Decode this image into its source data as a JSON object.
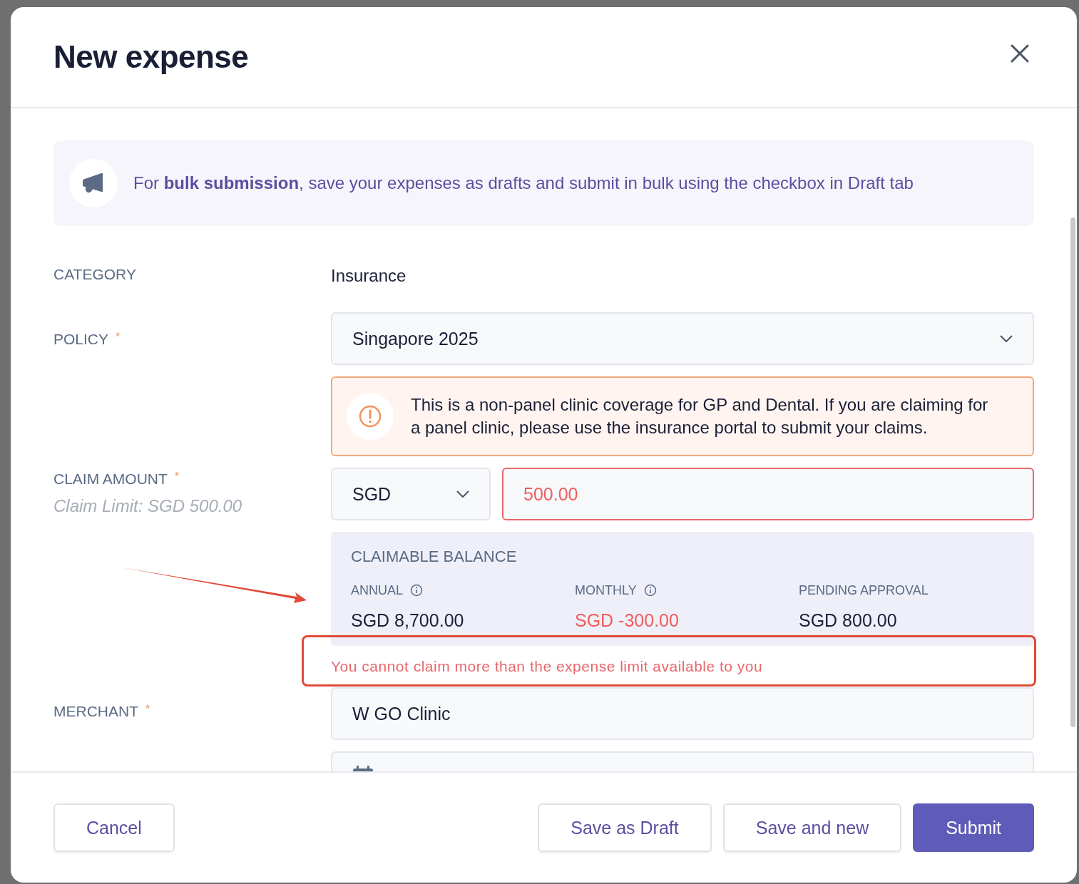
{
  "dialog": {
    "title": "New expense"
  },
  "banner": {
    "text": "For **bulk submission**, save your expenses as drafts and submit in bulk using the checkbox in Draft tab"
  },
  "category": {
    "label": "CATEGORY",
    "value": "Insurance"
  },
  "policy": {
    "label": "POLICY",
    "required_mark": "*",
    "value": "Singapore 2025",
    "notice": "This is a non-panel clinic coverage for GP and Dental. If you are claiming for a panel clinic, please use the insurance portal to submit your claims."
  },
  "claim_amount": {
    "label": "CLAIM AMOUNT",
    "required_mark": "*",
    "hint": "Claim Limit: SGD 500.00",
    "currency": "SGD",
    "amount": "500.00",
    "invalid": true
  },
  "balance": {
    "title": "CLAIMABLE BALANCE",
    "items": [
      {
        "label": "ANNUAL",
        "info": true,
        "value": "SGD 8,700.00",
        "negative": false
      },
      {
        "label": "MONTHLY",
        "info": true,
        "value": "SGD -300.00",
        "negative": true
      },
      {
        "label": "PENDING APPROVAL",
        "info": false,
        "value": "SGD 800.00",
        "negative": false
      }
    ]
  },
  "error": "You cannot claim more than the expense limit available to you",
  "merchant": {
    "label": "MERCHANT",
    "required_mark": "*",
    "value": "W GO Clinic"
  },
  "footer": {
    "buttons": [
      {
        "label": "Cancel",
        "kind": "secondary"
      },
      {
        "label": "Save as Draft",
        "kind": "secondary"
      },
      {
        "label": "Save and new",
        "kind": "secondary"
      },
      {
        "label": "Submit",
        "kind": "primary"
      }
    ]
  }
}
